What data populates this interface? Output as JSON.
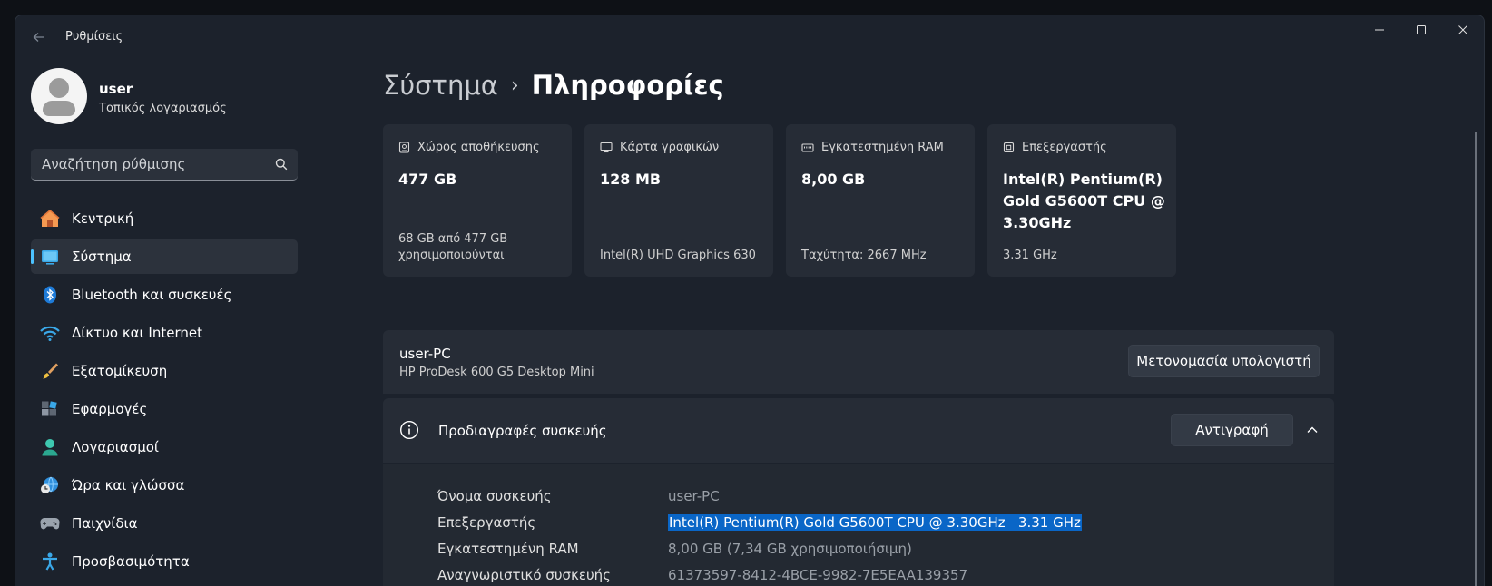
{
  "window": {
    "title": "Ρυθμίσεις"
  },
  "profile": {
    "name": "user",
    "subtitle": "Τοπικός λογαριασμός"
  },
  "search": {
    "placeholder": "Αναζήτηση ρύθμισης"
  },
  "sidebar": {
    "items": [
      {
        "label": "Κεντρική",
        "icon": "home-icon"
      },
      {
        "label": "Σύστημα",
        "icon": "system-icon",
        "active": true
      },
      {
        "label": "Bluetooth και συσκευές",
        "icon": "bluetooth-icon"
      },
      {
        "label": "Δίκτυο και Internet",
        "icon": "wifi-icon"
      },
      {
        "label": "Εξατομίκευση",
        "icon": "brush-icon"
      },
      {
        "label": "Εφαρμογές",
        "icon": "apps-icon"
      },
      {
        "label": "Λογαριασμοί",
        "icon": "account-icon"
      },
      {
        "label": "Ώρα και γλώσσα",
        "icon": "globe-clock-icon"
      },
      {
        "label": "Παιχνίδια",
        "icon": "gamepad-icon"
      },
      {
        "label": "Προσβασιμότητα",
        "icon": "accessibility-icon"
      }
    ]
  },
  "breadcrumb": {
    "parent": "Σύστημα",
    "separator": "›",
    "current": "Πληροφορίες"
  },
  "cards": [
    {
      "title": "Χώρος αποθήκευσης",
      "value": "477 GB",
      "sub": "68 GB από 477 GB χρησιμοποιούνται",
      "icon": "storage-icon"
    },
    {
      "title": "Κάρτα γραφικών",
      "value": "128 MB",
      "sub": "Intel(R) UHD Graphics 630",
      "icon": "display-icon"
    },
    {
      "title": "Εγκατεστημένη RAM",
      "value": "8,00 GB",
      "sub": "Ταχύτητα: 2667 MHz",
      "icon": "ram-icon"
    },
    {
      "title": "Επεξεργαστής",
      "value": "Intel(R) Pentium(R) Gold G5600T CPU @ 3.30GHz",
      "sub": "3.31 GHz",
      "icon": "cpu-icon"
    }
  ],
  "pc": {
    "name": "user-PC",
    "model": "HP ProDesk 600 G5 Desktop Mini",
    "rename_label": "Μετονομασία υπολογιστή"
  },
  "specs": {
    "title": "Προδιαγραφές συσκευής",
    "copy_label": "Αντιγραφή",
    "rows": [
      {
        "label": "Όνομα συσκευής",
        "value": "user-PC"
      },
      {
        "label": "Επεξεργαστής",
        "value": "Intel(R) Pentium(R) Gold G5600T CPU @ 3.30GHz   3.31 GHz",
        "selected": true
      },
      {
        "label": "Εγκατεστημένη RAM",
        "value": "8,00 GB (7,34 GB χρησιμοποιήσιμη)"
      },
      {
        "label": "Αναγνωριστικό συσκευής",
        "value": "61373597-8412-4BCE-9982-7E5EAA139357"
      }
    ]
  },
  "colors": {
    "accent": "#4cc2ff",
    "selection": "#0a66c7",
    "background": "#1c222c",
    "card": "#262c36"
  }
}
